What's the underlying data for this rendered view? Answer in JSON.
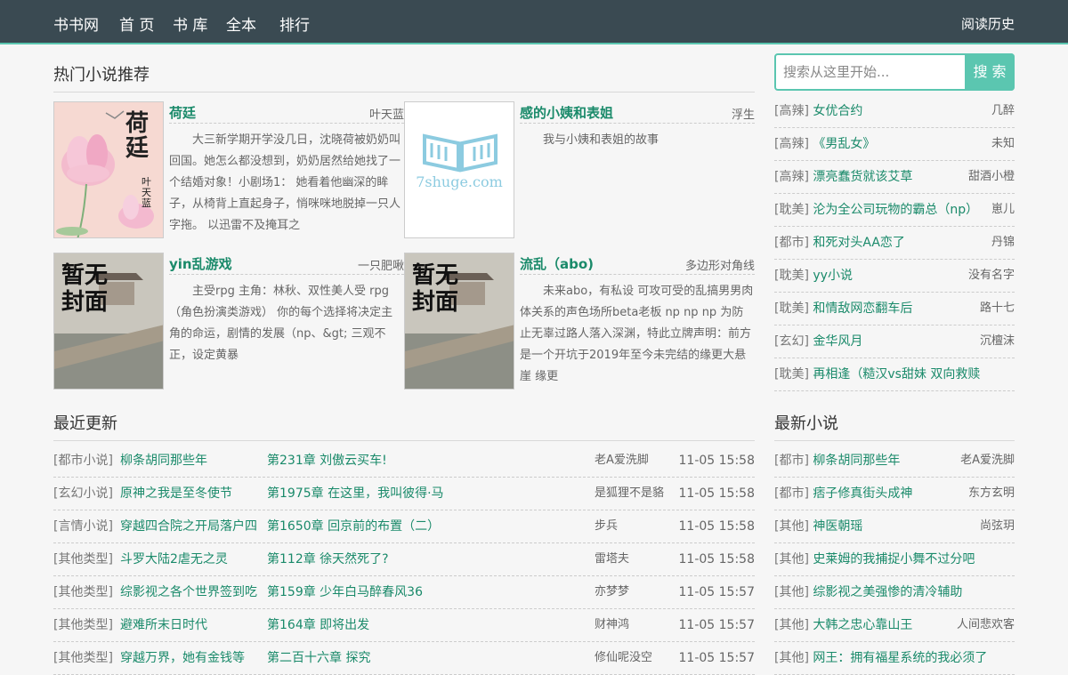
{
  "header": {
    "brand": "书书网",
    "nav": [
      "首 页",
      "书 库",
      "全本",
      "排行"
    ],
    "history": "阅读历史"
  },
  "hot": {
    "title": "热门小说推荐",
    "books": [
      {
        "title": "荷廷",
        "author": "叶天蓝",
        "desc": "大三新学期开学没几日，沈晓荷被奶奶叫回国。她怎么都没想到，奶奶居然给她找了一个结婚对象！小剧场1： 她看着他幽深的眸子，从椅背上直起身子，悄咪咪地脱掉一只人字拖。 以迅雷不及掩耳之",
        "cover_title": "荷廷",
        "cover_author": "叶天蓝"
      },
      {
        "title": "感的小姨和表姐",
        "author": "浮生",
        "desc": "我与小姨和表姐的故事",
        "cover_site": "7shuge.com"
      },
      {
        "title": "yin乱游戏",
        "author": "一只肥啾",
        "desc": "主受rpg 主角：林秋、双性美人受 rpg（角色扮演类游戏） 你的每个选择将决定主角的命运，剧情的发展（np、&gt; 三观不正，设定黄暴",
        "cover_text": "暂无封面"
      },
      {
        "title": "流乱（abo)",
        "author": "多边形对角线",
        "desc": "未来abo，有私设 可攻可受的乱搞男男肉体关系的声色场所beta老板 np np np 为防止无辜过路人落入深渊，特此立牌声明：前方是一个开坑于2019年至今未完结的缘更大悬崖 缘更",
        "cover_text": "暂无封面"
      }
    ]
  },
  "search": {
    "placeholder": "搜索从这里开始...",
    "button": "搜 索"
  },
  "side_hot": [
    {
      "tag": "[高辣]",
      "name": "女优合约",
      "author": "几醉"
    },
    {
      "tag": "[高辣]",
      "name": "《男乱女》",
      "author": "未知"
    },
    {
      "tag": "[高辣]",
      "name": "漂亮蠢货就该艾草",
      "author": "甜酒小橙"
    },
    {
      "tag": "[耽美]",
      "name": "沦为全公司玩物的霸总（np）",
      "author": "崽儿"
    },
    {
      "tag": "[都市]",
      "name": "和死对头AA恋了",
      "author": "丹锦"
    },
    {
      "tag": "[耽美]",
      "name": "yy小说",
      "author": "没有名字"
    },
    {
      "tag": "[耽美]",
      "name": "和情敌网恋翻车后",
      "author": "路十七"
    },
    {
      "tag": "[玄幻]",
      "name": "金华风月",
      "author": "沉檀沫"
    },
    {
      "tag": "[耽美]",
      "name": "再相逢（糙汉vs甜妹 双向救赎",
      "author": ""
    }
  ],
  "recent": {
    "title": "最近更新",
    "rows": [
      {
        "cat": "[都市小说]",
        "book": "柳条胡同那些年",
        "chapter": "第231章 刘傲云买车!",
        "author": "老A爱洗脚",
        "time": "11-05 15:58"
      },
      {
        "cat": "[玄幻小说]",
        "book": "原神之我是至冬使节",
        "chapter": "第1975章 在这里，我叫彼得·马",
        "author": "是狐狸不是貉",
        "time": "11-05 15:58"
      },
      {
        "cat": "[言情小说]",
        "book": "穿越四合院之开局落户四",
        "chapter": "第1650章 回京前的布置（二）",
        "author": "步兵",
        "time": "11-05 15:58"
      },
      {
        "cat": "[其他类型]",
        "book": "斗罗大陆2虐无之灵",
        "chapter": "第112章 徐天然死了?",
        "author": "雷塔夫",
        "time": "11-05 15:58"
      },
      {
        "cat": "[其他类型]",
        "book": "综影视之各个世界签到吃",
        "chapter": "第159章 少年白马醉春风36",
        "author": "亦梦梦",
        "time": "11-05 15:57"
      },
      {
        "cat": "[其他类型]",
        "book": "避难所末日时代",
        "chapter": "第164章 即将出发",
        "author": "财神鸿",
        "time": "11-05 15:57"
      },
      {
        "cat": "[其他类型]",
        "book": "穿越万界，她有金钱等",
        "chapter": "第二百十六章 探究",
        "author": "修仙呢没空",
        "time": "11-05 15:57"
      }
    ]
  },
  "newest": {
    "title": "最新小说",
    "rows": [
      {
        "tag": "[都市]",
        "name": "柳条胡同那些年",
        "author": "老A爱洗脚"
      },
      {
        "tag": "[都市]",
        "name": "痞子修真街头成神",
        "author": "东方玄明"
      },
      {
        "tag": "[其他]",
        "name": "神医朝瑶",
        "author": "尚弦玥"
      },
      {
        "tag": "[其他]",
        "name": "史莱姆的我捕捉小舞不过分吧",
        "author": ""
      },
      {
        "tag": "[其他]",
        "name": "综影视之美强惨的清冷辅助",
        "author": ""
      },
      {
        "tag": "[其他]",
        "name": "大韩之忠心靠山王",
        "author": "人间悲欢客"
      },
      {
        "tag": "[其他]",
        "name": "网王：拥有福星系统的我必须了",
        "author": ""
      }
    ]
  }
}
